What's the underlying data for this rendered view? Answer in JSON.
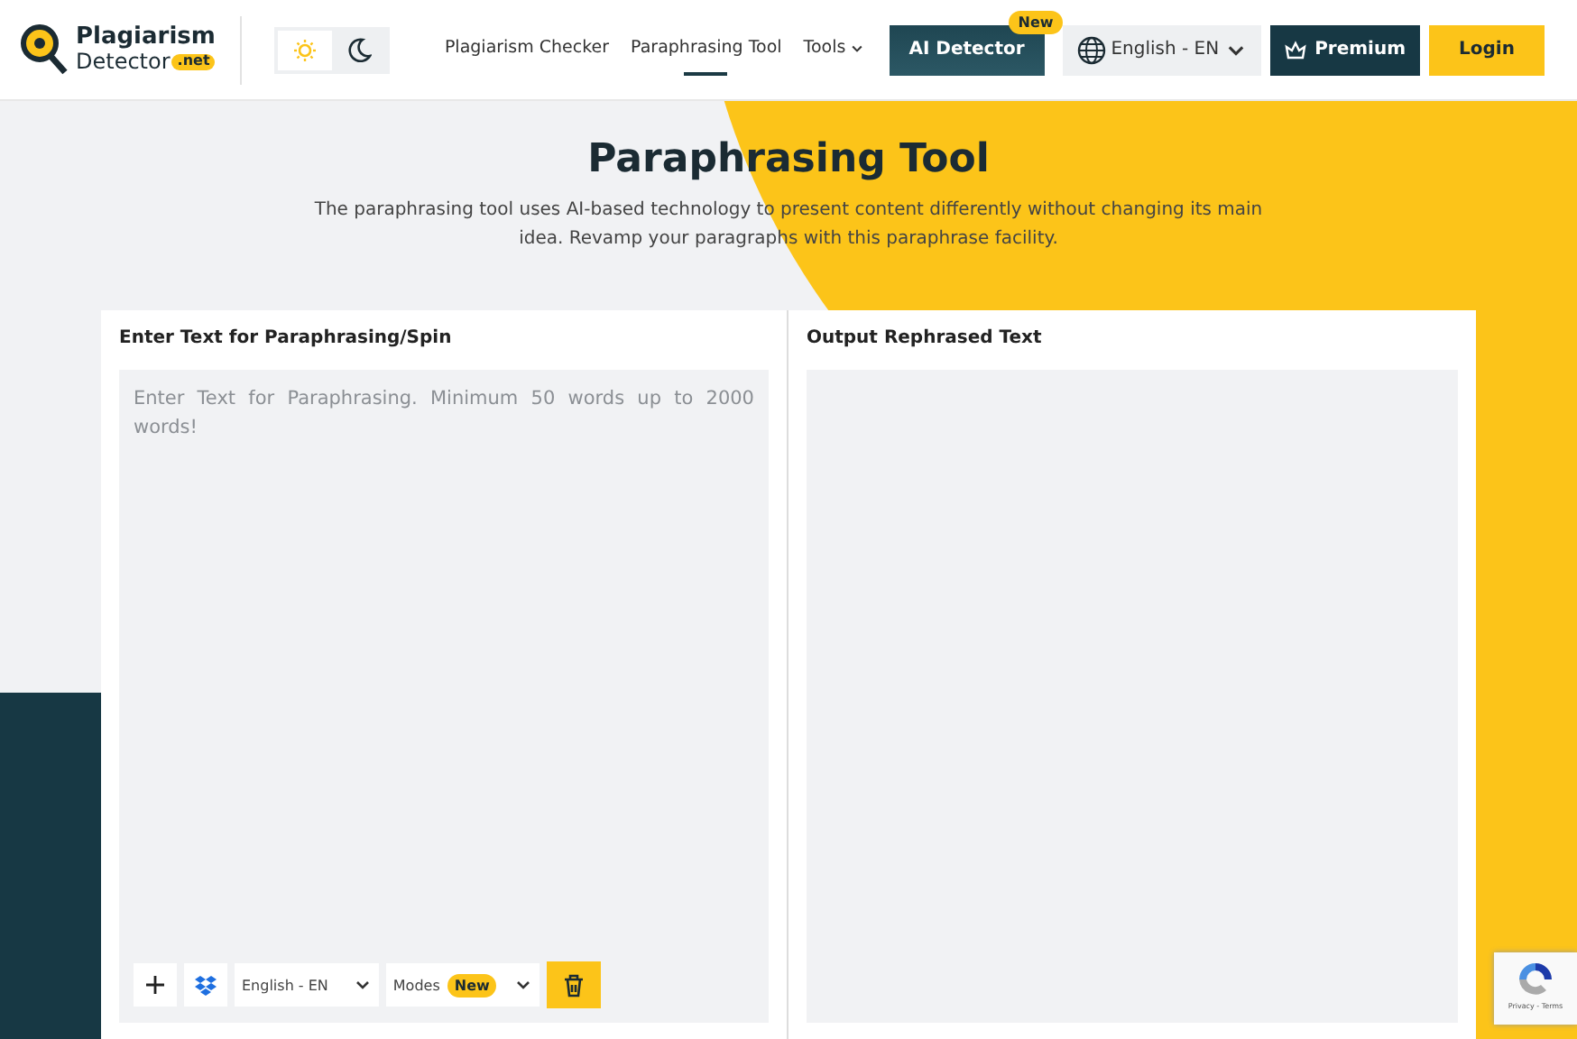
{
  "logo": {
    "line1": "Plagiarism",
    "line2": "Detector",
    "badge": ".net"
  },
  "theme_modes": [
    {
      "kind": "light",
      "selected": true
    },
    {
      "kind": "dark",
      "selected": false
    }
  ],
  "nav": [
    {
      "label": "Plagiarism Checker",
      "selected": false
    },
    {
      "label": "Paraphrasing Tool",
      "selected": true
    },
    {
      "label": "Tools",
      "selected": false
    }
  ],
  "ai_button": {
    "label": "AI Detector",
    "badge": "New"
  },
  "language": "English - EN",
  "premium": "Premium",
  "login": "Login",
  "hero": {
    "title": "Paraphrasing Tool",
    "description": "The paraphrasing tool uses AI-based technology to present content differently without changing its main idea. Revamp your paragraphs with this paraphrase facility."
  },
  "input_panel": {
    "heading": "Enter Text for Paraphrasing/Spin",
    "placeholder": "Enter Text for Paraphrasing. Minimum 50 words up to 2000 words!",
    "language": "English - EN",
    "modes": "Modes",
    "modes_badge": "New"
  },
  "output_panel": {
    "heading": "Output Rephrased Text"
  },
  "recaptcha": "Privacy - Terms"
}
